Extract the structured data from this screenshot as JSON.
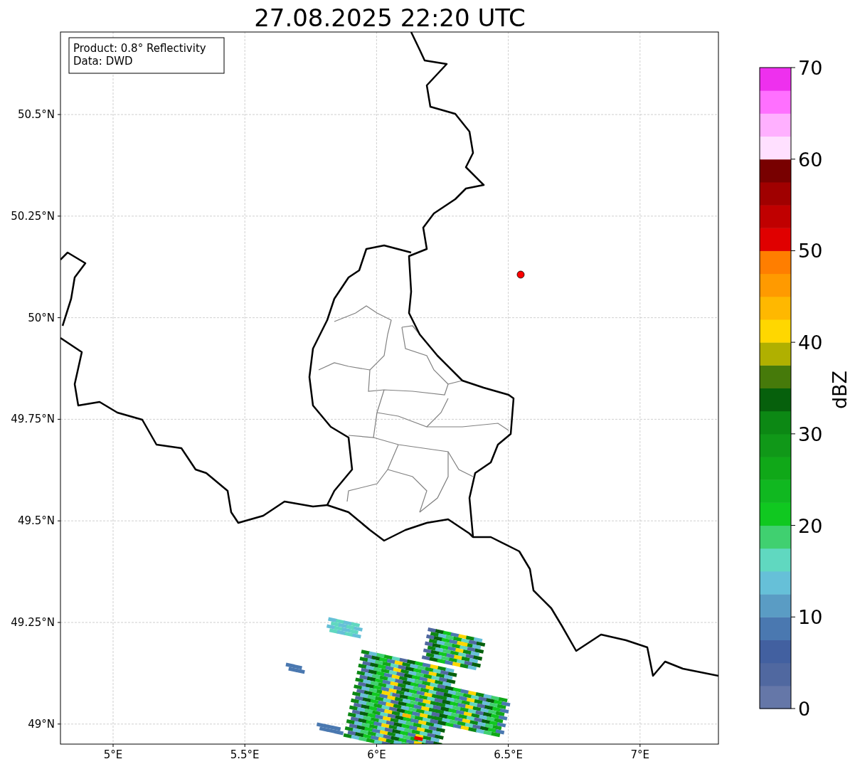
{
  "title": "27.08.2025 22:20 UTC",
  "info_box": {
    "lines": [
      "Product: 0.8° Reflectivity",
      "Data: DWD"
    ]
  },
  "map": {
    "lat_ticks": [
      "50.5°N",
      "50.25°N",
      "50°N",
      "49.75°N",
      "49.5°N",
      "49.25°N",
      "49°N"
    ],
    "lon_ticks": [
      "5°E",
      "5.5°E",
      "6°E",
      "6.5°E",
      "7°E"
    ]
  },
  "colorbar": {
    "label": "dBZ",
    "ticks": [
      "70",
      "60",
      "50",
      "40",
      "30",
      "20",
      "10",
      "0"
    ],
    "bands": [
      {
        "color": "#6577a8"
      },
      {
        "color": "#5068a0"
      },
      {
        "color": "#4260a0"
      },
      {
        "color": "#4a78b0"
      },
      {
        "color": "#5a9cc4"
      },
      {
        "color": "#66c0d8"
      },
      {
        "color": "#60d8c0"
      },
      {
        "color": "#40d070"
      },
      {
        "color": "#10c820"
      },
      {
        "color": "#10b820"
      },
      {
        "color": "#10a818"
      },
      {
        "color": "#109818"
      },
      {
        "color": "#0c8814"
      },
      {
        "color": "#06600c"
      },
      {
        "color": "#467a0a"
      },
      {
        "color": "#b0b000"
      },
      {
        "color": "#ffd700"
      },
      {
        "color": "#ffb800"
      },
      {
        "color": "#ff9a00"
      },
      {
        "color": "#ff7e00"
      },
      {
        "color": "#e00000"
      },
      {
        "color": "#c00000"
      },
      {
        "color": "#a00000"
      },
      {
        "color": "#780000"
      },
      {
        "color": "#ffe0ff"
      },
      {
        "color": "#ffb0ff"
      },
      {
        "color": "#ff70ff"
      },
      {
        "color": "#ee30ee"
      }
    ]
  }
}
